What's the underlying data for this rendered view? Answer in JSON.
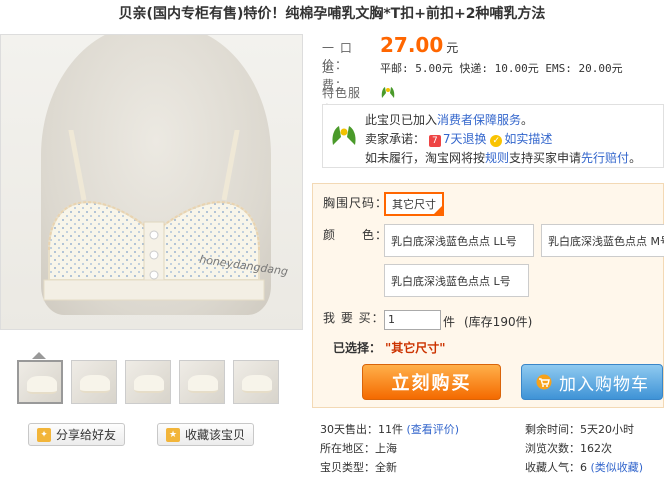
{
  "title": "贝亲(国内专柜有售)特价！纯棉孕哺乳文胸*T扣+前扣+2种哺乳方法",
  "image": {
    "watermark": "honeydangdang"
  },
  "buttons": {
    "share": "分享给好友",
    "favorite": "收藏该宝贝",
    "buy_now": "立刻购买",
    "add_to_cart": "加入购物车"
  },
  "price": {
    "label": "一 口 价：",
    "value": "27.00",
    "unit": "元"
  },
  "shipping": {
    "label": "运　　费：",
    "text": "平邮: 5.00元 快递: 10.00元 EMS: 20.00元"
  },
  "features": {
    "label": "特色服务："
  },
  "guarantee": {
    "line1_prefix": "此宝贝已加入",
    "line1_link": "消费者保障服务",
    "line1_suffix": "。",
    "line2_prefix": "卖家承诺：",
    "refund": "7天退换",
    "truthful": "如实描述",
    "line3_prefix": "如未履行，淘宝网将按",
    "rules_link": "规则",
    "line3_mid": "支持买家申请",
    "compensation_link": "先行赔付",
    "line3_suffix": "。"
  },
  "buybox": {
    "size_label": "胸围尺码：",
    "size_selected": "其它尺寸",
    "color_label": "颜　　色：",
    "color_options": [
      "乳白底深浅蓝色点点 LL号",
      "乳白底深浅蓝色点点 M号",
      "乳白底深浅蓝色点点 L号"
    ],
    "qty_label": "我 要 买：",
    "qty_value": "1",
    "qty_unit": "件",
    "stock": "(库存190件)",
    "selected_label": "已选择：",
    "selected_value": "\"其它尺寸\""
  },
  "stats": {
    "sold_30": "30天售出：11件",
    "view_reviews": "(查看评价)",
    "remaining_time": "剩余时间：5天20小时",
    "location": "所在地区：上海",
    "views": "浏览次数：162次",
    "item_type": "宝贝类型：全新",
    "favorites_count": "收藏人气：6",
    "similar_favorites": "(类似收藏)"
  },
  "colors": {
    "price": "#ff6600",
    "link": "#3366cc",
    "buy_now": "#f46a00",
    "add_to_cart": "#3f93d6"
  }
}
